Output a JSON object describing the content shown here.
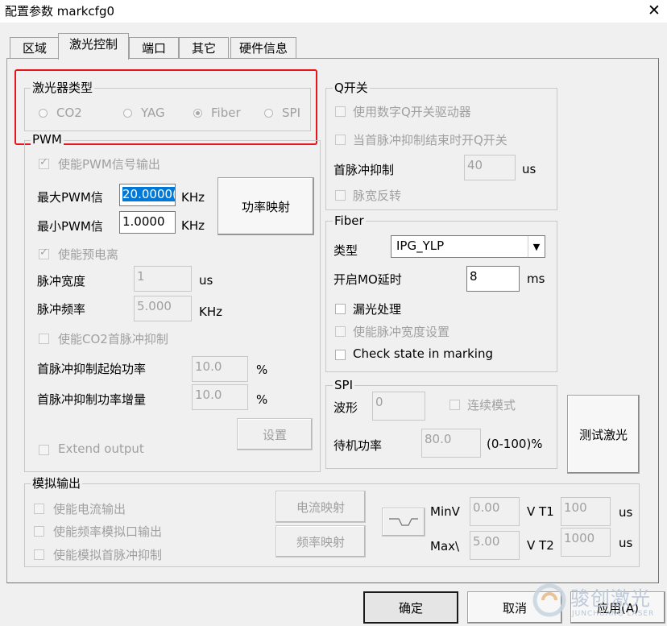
{
  "window": {
    "title": "配置参数 markcfg0",
    "close_glyph": "✕"
  },
  "tabs": [
    {
      "label": "区域"
    },
    {
      "label": "激光控制"
    },
    {
      "label": "端口"
    },
    {
      "label": "其它"
    },
    {
      "label": "硬件信息"
    }
  ],
  "laser_type": {
    "legend": "激光器类型",
    "options": [
      {
        "label": "CO2",
        "selected": false
      },
      {
        "label": "YAG",
        "selected": false
      },
      {
        "label": "Fiber",
        "selected": true
      },
      {
        "label": "SPI",
        "selected": false
      }
    ]
  },
  "pwm": {
    "legend": "PWM",
    "enable_label": "使能PWM信号输出",
    "max_label": "最大PWM信",
    "max_value": "20.0000(",
    "max_unit": "KHz",
    "min_label": "最小PWM信",
    "min_value": "1.0000",
    "min_unit": "KHz",
    "power_map_button": "功率映射",
    "enable_preion_label": "使能预电离",
    "pulse_width_label": "脉冲宽度",
    "pulse_width_value": "1",
    "pulse_width_unit": "us",
    "pulse_freq_label": "脉冲频率",
    "pulse_freq_value": "5.000",
    "pulse_freq_unit": "KHz",
    "co2_first_pulse_label": "使能CO2首脉冲抑制",
    "first_pulse_start_label": "首脉冲抑制起始功率",
    "first_pulse_start_value": "10.0",
    "first_pulse_start_unit": "%",
    "first_pulse_inc_label": "首脉冲抑制功率增量",
    "first_pulse_inc_value": "10.0",
    "first_pulse_inc_unit": "%",
    "settings_button": "设置",
    "extend_output_label": "Extend output"
  },
  "qswitch": {
    "legend": "Q开关",
    "digital_driver_label": "使用数字Q开关驱动器",
    "open_after_label": "当首脉冲抑制结束时开Q开关",
    "first_pulse_label": "首脉冲抑制",
    "first_pulse_value": "40",
    "first_pulse_unit": "us",
    "pulse_invert_label": "脉宽反转"
  },
  "fiber": {
    "legend": "Fiber",
    "type_label": "类型",
    "type_value": "IPG_YLP",
    "mo_delay_label": "开启MO延时",
    "mo_delay_value": "8",
    "mo_delay_unit": "ms",
    "leak_label": "漏光处理",
    "pulse_width_set_label": "使能脉冲宽度设置",
    "check_state_label": "Check state in marking"
  },
  "spi": {
    "legend": "SPI",
    "waveform_label": "波形",
    "waveform_value": "0",
    "continuous_label": "连续模式",
    "standby_label": "待机功率",
    "standby_value": "80.0",
    "standby_unit": "(0-100)%"
  },
  "test_laser_button": "测试激光",
  "analog": {
    "legend": "模拟输出",
    "current_out_label": "使能电流输出",
    "freq_analog_label": "使能频率模拟口输出",
    "first_pulse_analog_label": "使能模拟首脉冲抑制",
    "current_map_button": "电流映射",
    "freq_map_button": "频率映射",
    "minv_label": "MinV",
    "minv_value": "0.00",
    "maxv_label": "Max\\",
    "maxv_value": "5.00",
    "vt1_label": "V T1",
    "vt1_value": "100",
    "vt1_unit": "us",
    "vt2_label": "V T2",
    "vt2_value": "1000",
    "vt2_unit": "us"
  },
  "footer": {
    "ok_button": "确定",
    "cancel_button": "取消",
    "apply_button": "应用(A)"
  },
  "watermark": {
    "cn": "骏创激光",
    "en": "JUNCHUANG LASER"
  },
  "colors": {
    "highlight_box": "#e8141b",
    "selection": "#0078d7",
    "disabled_text": "#a0a0a0"
  }
}
